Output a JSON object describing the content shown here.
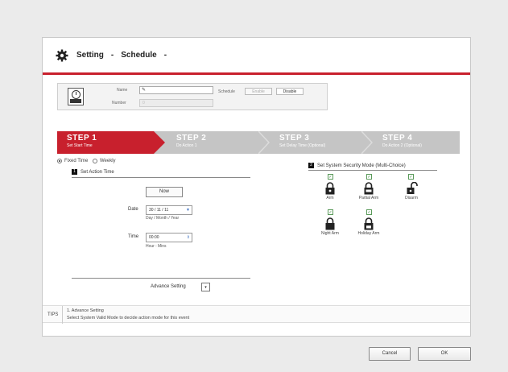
{
  "title": {
    "setting": "Setting",
    "separator": "-",
    "schedule": "Schedule",
    "trailing": "-"
  },
  "info": {
    "name_label": "Name",
    "name_value": "",
    "number_label": "Number",
    "number_value": "0",
    "schedule_label": "Schedule",
    "enable_label": "Enable",
    "disable_label": "Disable"
  },
  "steps": [
    {
      "heading": "STEP 1",
      "sub": "Set Start Time",
      "active": true
    },
    {
      "heading": "STEP 2",
      "sub": "Do Action 1",
      "active": false
    },
    {
      "heading": "STEP 3",
      "sub": "Set Delay Time (Optional)",
      "active": false
    },
    {
      "heading": "STEP 4",
      "sub": "Do Action 2 (Optional)",
      "active": false
    }
  ],
  "time_mode": {
    "fixed": "Fixed Time",
    "weekly": "Weekly",
    "selected": "Fixed Time"
  },
  "action_time": {
    "badge": "1",
    "title": "Set Action Time",
    "now_label": "Now",
    "date_label": "Date",
    "date_value": "30 / 11 / 11",
    "date_hint": "Day / Month / Year",
    "time_label": "Time",
    "time_value": "00:00",
    "time_hint": "Hour : Mins",
    "advance_label": "Advance Setting"
  },
  "security": {
    "badge": "2",
    "title": "Set System Security Mode (Multi-Choice)",
    "modes": [
      {
        "label": "Arm",
        "checked": true
      },
      {
        "label": "Partial Arm",
        "checked": true
      },
      {
        "label": "Disarm",
        "checked": true
      },
      {
        "label": "Night Arm",
        "checked": true
      },
      {
        "label": "Holiday Arm",
        "checked": true
      }
    ]
  },
  "tips": {
    "label": "TIPS",
    "title": "1. Advance Setting",
    "text": "Select System Valid Mode to decide action mode for this event"
  },
  "buttons": {
    "cancel": "Cancel",
    "ok": "OK"
  },
  "colors": {
    "accent": "#c8202d",
    "step_inactive": "#c5c5c5"
  }
}
